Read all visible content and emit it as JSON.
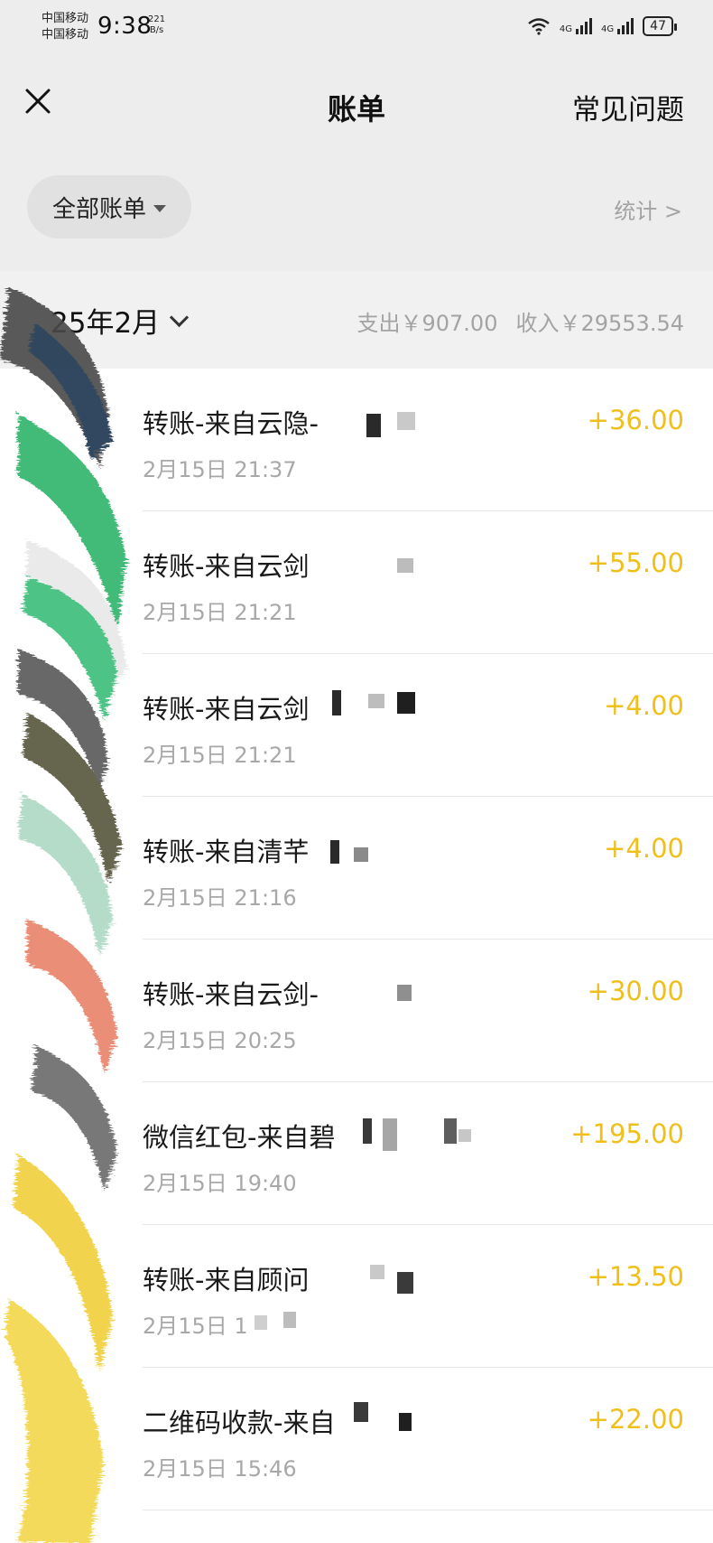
{
  "status_bar": {
    "carrier_1": "中国移动",
    "carrier_2": "中国移动",
    "time": "9:38",
    "net_speed_value": "221",
    "net_speed_unit": "B/s",
    "network_label": "4G",
    "battery": "47"
  },
  "nav": {
    "title": "账单",
    "faq": "常见问题"
  },
  "filter": {
    "label": "全部账单",
    "stats": "统计 >"
  },
  "month": {
    "label": "25年2月",
    "expense": "支出￥907.00",
    "income": "收入￥29553.54"
  },
  "transactions": [
    {
      "title": "转账-来自云隐-",
      "time": "2月15日 21:37",
      "amount": "+36.00"
    },
    {
      "title": "转账-来自云剑",
      "time": "2月15日 21:21",
      "amount": "+55.00"
    },
    {
      "title": "转账-来自云剑",
      "time": "2月15日 21:21",
      "amount": "+4.00"
    },
    {
      "title": "转账-来自清芊",
      "time": "2月15日 21:16",
      "amount": "+4.00"
    },
    {
      "title": "转账-来自云剑-",
      "time": "2月15日 20:25",
      "amount": "+30.00"
    },
    {
      "title": "微信红包-来自碧",
      "time": "2月15日 19:40",
      "amount": "+195.00"
    },
    {
      "title": "转账-来自顾问",
      "time": "2月15日 1",
      "amount": "+13.50"
    },
    {
      "title": "二维码收款-来自",
      "time": "2月15日 15:46",
      "amount": "+22.00"
    }
  ],
  "colors": {
    "amount": "#f0bf1b",
    "header_bg": "#ededed",
    "muted": "#a3a3a3"
  }
}
